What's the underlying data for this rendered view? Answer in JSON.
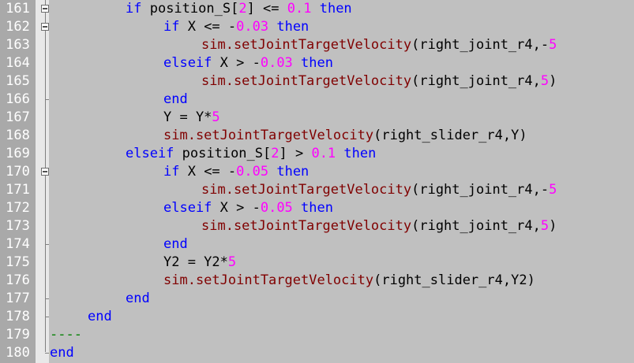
{
  "colors": {
    "background": "#c0c0c0",
    "gutter": "#a9a9a9",
    "line_number": "#ffffff",
    "keyword": "#0000ff",
    "number": "#ff00ff",
    "function": "#800000",
    "identifier": "#000000",
    "comment": "#008000"
  },
  "lines": [
    {
      "num": "161",
      "fold": "box",
      "indent": 2,
      "tokens": [
        [
          "kw",
          "if"
        ],
        [
          "var",
          " position_S["
        ],
        [
          "num",
          "2"
        ],
        [
          "var",
          "] <= "
        ],
        [
          "num",
          "0.1"
        ],
        [
          "var",
          " "
        ],
        [
          "kw",
          "then"
        ]
      ]
    },
    {
      "num": "162",
      "fold": "box",
      "indent": 3,
      "tokens": [
        [
          "kw",
          "if"
        ],
        [
          "var",
          " X <= -"
        ],
        [
          "num",
          "0.03"
        ],
        [
          "var",
          " "
        ],
        [
          "kw",
          "then"
        ]
      ]
    },
    {
      "num": "163",
      "fold": "",
      "indent": 4,
      "tokens": [
        [
          "fn",
          "sim.setJointTargetVelocity"
        ],
        [
          "var",
          "(right_joint_r4,-"
        ],
        [
          "num",
          "5"
        ]
      ]
    },
    {
      "num": "164",
      "fold": "",
      "indent": 3,
      "tokens": [
        [
          "kw",
          "elseif"
        ],
        [
          "var",
          " X > -"
        ],
        [
          "num",
          "0.03"
        ],
        [
          "var",
          " "
        ],
        [
          "kw",
          "then"
        ]
      ]
    },
    {
      "num": "165",
      "fold": "",
      "indent": 4,
      "tokens": [
        [
          "fn",
          "sim.setJointTargetVelocity"
        ],
        [
          "var",
          "(right_joint_r4,"
        ],
        [
          "num",
          "5"
        ],
        [
          "var",
          ")"
        ]
      ]
    },
    {
      "num": "166",
      "fold": "tick",
      "indent": 3,
      "tokens": [
        [
          "kw",
          "end"
        ]
      ]
    },
    {
      "num": "167",
      "fold": "",
      "indent": 3,
      "tokens": [
        [
          "var",
          "Y = Y*"
        ],
        [
          "num",
          "5"
        ]
      ]
    },
    {
      "num": "168",
      "fold": "",
      "indent": 3,
      "tokens": [
        [
          "fn",
          "sim.setJointTargetVelocity"
        ],
        [
          "var",
          "(right_slider_r4,Y)"
        ]
      ]
    },
    {
      "num": "169",
      "fold": "",
      "indent": 2,
      "tokens": [
        [
          "kw",
          "elseif"
        ],
        [
          "var",
          " position_S["
        ],
        [
          "num",
          "2"
        ],
        [
          "var",
          "] > "
        ],
        [
          "num",
          "0.1"
        ],
        [
          "var",
          " "
        ],
        [
          "kw",
          "then"
        ]
      ]
    },
    {
      "num": "170",
      "fold": "box",
      "indent": 3,
      "tokens": [
        [
          "kw",
          "if"
        ],
        [
          "var",
          " X <= -"
        ],
        [
          "num",
          "0.05"
        ],
        [
          "var",
          " "
        ],
        [
          "kw",
          "then"
        ]
      ]
    },
    {
      "num": "171",
      "fold": "",
      "indent": 4,
      "tokens": [
        [
          "fn",
          "sim.setJointTargetVelocity"
        ],
        [
          "var",
          "(right_joint_r4,-"
        ],
        [
          "num",
          "5"
        ]
      ]
    },
    {
      "num": "172",
      "fold": "",
      "indent": 3,
      "tokens": [
        [
          "kw",
          "elseif"
        ],
        [
          "var",
          " X > -"
        ],
        [
          "num",
          "0.05"
        ],
        [
          "var",
          " "
        ],
        [
          "kw",
          "then"
        ]
      ]
    },
    {
      "num": "173",
      "fold": "",
      "indent": 4,
      "tokens": [
        [
          "fn",
          "sim.setJointTargetVelocity"
        ],
        [
          "var",
          "(right_joint_r4,"
        ],
        [
          "num",
          "5"
        ],
        [
          "var",
          ")"
        ]
      ]
    },
    {
      "num": "174",
      "fold": "tick",
      "indent": 3,
      "tokens": [
        [
          "kw",
          "end"
        ]
      ]
    },
    {
      "num": "175",
      "fold": "",
      "indent": 3,
      "tokens": [
        [
          "var",
          "Y2 = Y2*"
        ],
        [
          "num",
          "5"
        ]
      ]
    },
    {
      "num": "176",
      "fold": "",
      "indent": 3,
      "tokens": [
        [
          "fn",
          "sim.setJointTargetVelocity"
        ],
        [
          "var",
          "(right_slider_r4,Y2)"
        ]
      ]
    },
    {
      "num": "177",
      "fold": "tick",
      "indent": 2,
      "tokens": [
        [
          "kw",
          "end"
        ]
      ]
    },
    {
      "num": "178",
      "fold": "tick",
      "indent": 1,
      "tokens": [
        [
          "kw",
          "end"
        ]
      ]
    },
    {
      "num": "179",
      "fold": "",
      "indent": 0,
      "tokens": [
        [
          "comment",
          "----"
        ]
      ]
    },
    {
      "num": "180",
      "fold": "tick",
      "indent": 0,
      "tokens": [
        [
          "kw",
          "end"
        ]
      ]
    }
  ]
}
